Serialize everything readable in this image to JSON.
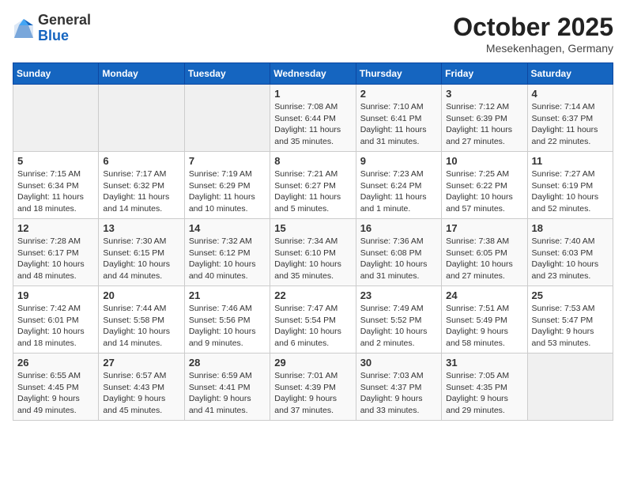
{
  "header": {
    "logo_general": "General",
    "logo_blue": "Blue",
    "month": "October 2025",
    "location": "Mesekenhagen, Germany"
  },
  "weekdays": [
    "Sunday",
    "Monday",
    "Tuesday",
    "Wednesday",
    "Thursday",
    "Friday",
    "Saturday"
  ],
  "weeks": [
    [
      {
        "day": "",
        "info": ""
      },
      {
        "day": "",
        "info": ""
      },
      {
        "day": "",
        "info": ""
      },
      {
        "day": "1",
        "info": "Sunrise: 7:08 AM\nSunset: 6:44 PM\nDaylight: 11 hours\nand 35 minutes."
      },
      {
        "day": "2",
        "info": "Sunrise: 7:10 AM\nSunset: 6:41 PM\nDaylight: 11 hours\nand 31 minutes."
      },
      {
        "day": "3",
        "info": "Sunrise: 7:12 AM\nSunset: 6:39 PM\nDaylight: 11 hours\nand 27 minutes."
      },
      {
        "day": "4",
        "info": "Sunrise: 7:14 AM\nSunset: 6:37 PM\nDaylight: 11 hours\nand 22 minutes."
      }
    ],
    [
      {
        "day": "5",
        "info": "Sunrise: 7:15 AM\nSunset: 6:34 PM\nDaylight: 11 hours\nand 18 minutes."
      },
      {
        "day": "6",
        "info": "Sunrise: 7:17 AM\nSunset: 6:32 PM\nDaylight: 11 hours\nand 14 minutes."
      },
      {
        "day": "7",
        "info": "Sunrise: 7:19 AM\nSunset: 6:29 PM\nDaylight: 11 hours\nand 10 minutes."
      },
      {
        "day": "8",
        "info": "Sunrise: 7:21 AM\nSunset: 6:27 PM\nDaylight: 11 hours\nand 5 minutes."
      },
      {
        "day": "9",
        "info": "Sunrise: 7:23 AM\nSunset: 6:24 PM\nDaylight: 11 hours\nand 1 minute."
      },
      {
        "day": "10",
        "info": "Sunrise: 7:25 AM\nSunset: 6:22 PM\nDaylight: 10 hours\nand 57 minutes."
      },
      {
        "day": "11",
        "info": "Sunrise: 7:27 AM\nSunset: 6:19 PM\nDaylight: 10 hours\nand 52 minutes."
      }
    ],
    [
      {
        "day": "12",
        "info": "Sunrise: 7:28 AM\nSunset: 6:17 PM\nDaylight: 10 hours\nand 48 minutes."
      },
      {
        "day": "13",
        "info": "Sunrise: 7:30 AM\nSunset: 6:15 PM\nDaylight: 10 hours\nand 44 minutes."
      },
      {
        "day": "14",
        "info": "Sunrise: 7:32 AM\nSunset: 6:12 PM\nDaylight: 10 hours\nand 40 minutes."
      },
      {
        "day": "15",
        "info": "Sunrise: 7:34 AM\nSunset: 6:10 PM\nDaylight: 10 hours\nand 35 minutes."
      },
      {
        "day": "16",
        "info": "Sunrise: 7:36 AM\nSunset: 6:08 PM\nDaylight: 10 hours\nand 31 minutes."
      },
      {
        "day": "17",
        "info": "Sunrise: 7:38 AM\nSunset: 6:05 PM\nDaylight: 10 hours\nand 27 minutes."
      },
      {
        "day": "18",
        "info": "Sunrise: 7:40 AM\nSunset: 6:03 PM\nDaylight: 10 hours\nand 23 minutes."
      }
    ],
    [
      {
        "day": "19",
        "info": "Sunrise: 7:42 AM\nSunset: 6:01 PM\nDaylight: 10 hours\nand 18 minutes."
      },
      {
        "day": "20",
        "info": "Sunrise: 7:44 AM\nSunset: 5:58 PM\nDaylight: 10 hours\nand 14 minutes."
      },
      {
        "day": "21",
        "info": "Sunrise: 7:46 AM\nSunset: 5:56 PM\nDaylight: 10 hours\nand 9 minutes."
      },
      {
        "day": "22",
        "info": "Sunrise: 7:47 AM\nSunset: 5:54 PM\nDaylight: 10 hours\nand 6 minutes."
      },
      {
        "day": "23",
        "info": "Sunrise: 7:49 AM\nSunset: 5:52 PM\nDaylight: 10 hours\nand 2 minutes."
      },
      {
        "day": "24",
        "info": "Sunrise: 7:51 AM\nSunset: 5:49 PM\nDaylight: 9 hours\nand 58 minutes."
      },
      {
        "day": "25",
        "info": "Sunrise: 7:53 AM\nSunset: 5:47 PM\nDaylight: 9 hours\nand 53 minutes."
      }
    ],
    [
      {
        "day": "26",
        "info": "Sunrise: 6:55 AM\nSunset: 4:45 PM\nDaylight: 9 hours\nand 49 minutes."
      },
      {
        "day": "27",
        "info": "Sunrise: 6:57 AM\nSunset: 4:43 PM\nDaylight: 9 hours\nand 45 minutes."
      },
      {
        "day": "28",
        "info": "Sunrise: 6:59 AM\nSunset: 4:41 PM\nDaylight: 9 hours\nand 41 minutes."
      },
      {
        "day": "29",
        "info": "Sunrise: 7:01 AM\nSunset: 4:39 PM\nDaylight: 9 hours\nand 37 minutes."
      },
      {
        "day": "30",
        "info": "Sunrise: 7:03 AM\nSunset: 4:37 PM\nDaylight: 9 hours\nand 33 minutes."
      },
      {
        "day": "31",
        "info": "Sunrise: 7:05 AM\nSunset: 4:35 PM\nDaylight: 9 hours\nand 29 minutes."
      },
      {
        "day": "",
        "info": ""
      }
    ]
  ]
}
